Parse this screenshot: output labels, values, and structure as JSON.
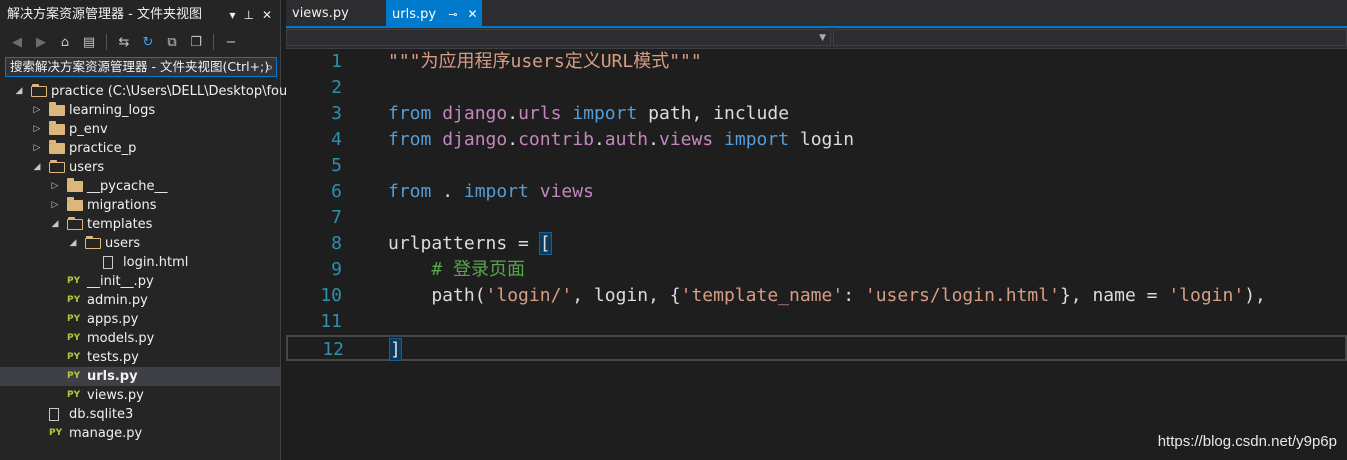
{
  "explorer": {
    "title": "解决方案资源管理器 - 文件夹视图",
    "search_placeholder": "搜索解决方案资源管理器 - 文件夹视图(Ctrl+;)",
    "tree": [
      {
        "label": "practice (C:\\Users\\DELL\\Desktop\\four\\l",
        "depth": 0,
        "kind": "folder-open",
        "arrow": "expanded"
      },
      {
        "label": "learning_logs",
        "depth": 1,
        "kind": "folder",
        "arrow": "collapsed"
      },
      {
        "label": "p_env",
        "depth": 1,
        "kind": "folder",
        "arrow": "collapsed"
      },
      {
        "label": "practice_p",
        "depth": 1,
        "kind": "folder",
        "arrow": "collapsed"
      },
      {
        "label": "users",
        "depth": 1,
        "kind": "folder-open",
        "arrow": "expanded"
      },
      {
        "label": "__pycache__",
        "depth": 2,
        "kind": "folder",
        "arrow": "collapsed"
      },
      {
        "label": "migrations",
        "depth": 2,
        "kind": "folder",
        "arrow": "collapsed"
      },
      {
        "label": "templates",
        "depth": 2,
        "kind": "folder-open",
        "arrow": "expanded"
      },
      {
        "label": "users",
        "depth": 3,
        "kind": "folder-open",
        "arrow": "expanded"
      },
      {
        "label": "login.html",
        "depth": 4,
        "kind": "file",
        "arrow": "none"
      },
      {
        "label": "__init__.py",
        "depth": 2,
        "kind": "py",
        "arrow": "none"
      },
      {
        "label": "admin.py",
        "depth": 2,
        "kind": "py",
        "arrow": "none"
      },
      {
        "label": "apps.py",
        "depth": 2,
        "kind": "py",
        "arrow": "none"
      },
      {
        "label": "models.py",
        "depth": 2,
        "kind": "py",
        "arrow": "none"
      },
      {
        "label": "tests.py",
        "depth": 2,
        "kind": "py",
        "arrow": "none"
      },
      {
        "label": "urls.py",
        "depth": 2,
        "kind": "py",
        "arrow": "none",
        "selected": true
      },
      {
        "label": "views.py",
        "depth": 2,
        "kind": "py",
        "arrow": "none"
      },
      {
        "label": "db.sqlite3",
        "depth": 1,
        "kind": "file",
        "arrow": "none"
      },
      {
        "label": "manage.py",
        "depth": 1,
        "kind": "py",
        "arrow": "none"
      }
    ],
    "py_badge": "PY"
  },
  "tabs": [
    {
      "label": "views.py",
      "active": false
    },
    {
      "label": "urls.py",
      "active": true
    }
  ],
  "editor": {
    "line_numbers": [
      "1",
      "2",
      "3",
      "4",
      "5",
      "6",
      "7",
      "8",
      "9",
      "10",
      "11",
      "12"
    ],
    "lines": [
      [
        {
          "t": "\"\"\"为应用程序users定义URL模式\"\"\"",
          "c": "str"
        }
      ],
      [],
      [
        {
          "t": "from",
          "c": "kw"
        },
        {
          "t": " ",
          "c": "txt"
        },
        {
          "t": "django",
          "c": "mod"
        },
        {
          "t": ".",
          "c": "txt"
        },
        {
          "t": "urls",
          "c": "mod"
        },
        {
          "t": " ",
          "c": "txt"
        },
        {
          "t": "import",
          "c": "kw"
        },
        {
          "t": " path, include",
          "c": "txt"
        }
      ],
      [
        {
          "t": "from",
          "c": "kw"
        },
        {
          "t": " ",
          "c": "txt"
        },
        {
          "t": "django",
          "c": "mod"
        },
        {
          "t": ".",
          "c": "txt"
        },
        {
          "t": "contrib",
          "c": "mod"
        },
        {
          "t": ".",
          "c": "txt"
        },
        {
          "t": "auth",
          "c": "mod"
        },
        {
          "t": ".",
          "c": "txt"
        },
        {
          "t": "views",
          "c": "mod"
        },
        {
          "t": " ",
          "c": "txt"
        },
        {
          "t": "import",
          "c": "kw"
        },
        {
          "t": " login",
          "c": "txt"
        }
      ],
      [],
      [
        {
          "t": "from",
          "c": "kw"
        },
        {
          "t": " . ",
          "c": "txt"
        },
        {
          "t": "import",
          "c": "kw"
        },
        {
          "t": " ",
          "c": "txt"
        },
        {
          "t": "views",
          "c": "mod"
        }
      ],
      [],
      [
        {
          "t": "urlpatterns = ",
          "c": "txt"
        },
        {
          "t": "[",
          "c": "brk"
        }
      ],
      [
        {
          "t": "    ",
          "c": "txt"
        },
        {
          "t": "# 登录页面",
          "c": "cmt"
        }
      ],
      [
        {
          "t": "    path(",
          "c": "txt"
        },
        {
          "t": "'login/'",
          "c": "str"
        },
        {
          "t": ", login, {",
          "c": "txt"
        },
        {
          "t": "'template_name'",
          "c": "str"
        },
        {
          "t": ": ",
          "c": "txt"
        },
        {
          "t": "'users/login.html'",
          "c": "str"
        },
        {
          "t": "}, name = ",
          "c": "txt"
        },
        {
          "t": "'login'",
          "c": "str"
        },
        {
          "t": "),",
          "c": "txt"
        }
      ],
      [],
      [
        {
          "t": "]",
          "c": "brk"
        }
      ]
    ]
  },
  "watermark": "https://blog.csdn.net/y9p6p"
}
